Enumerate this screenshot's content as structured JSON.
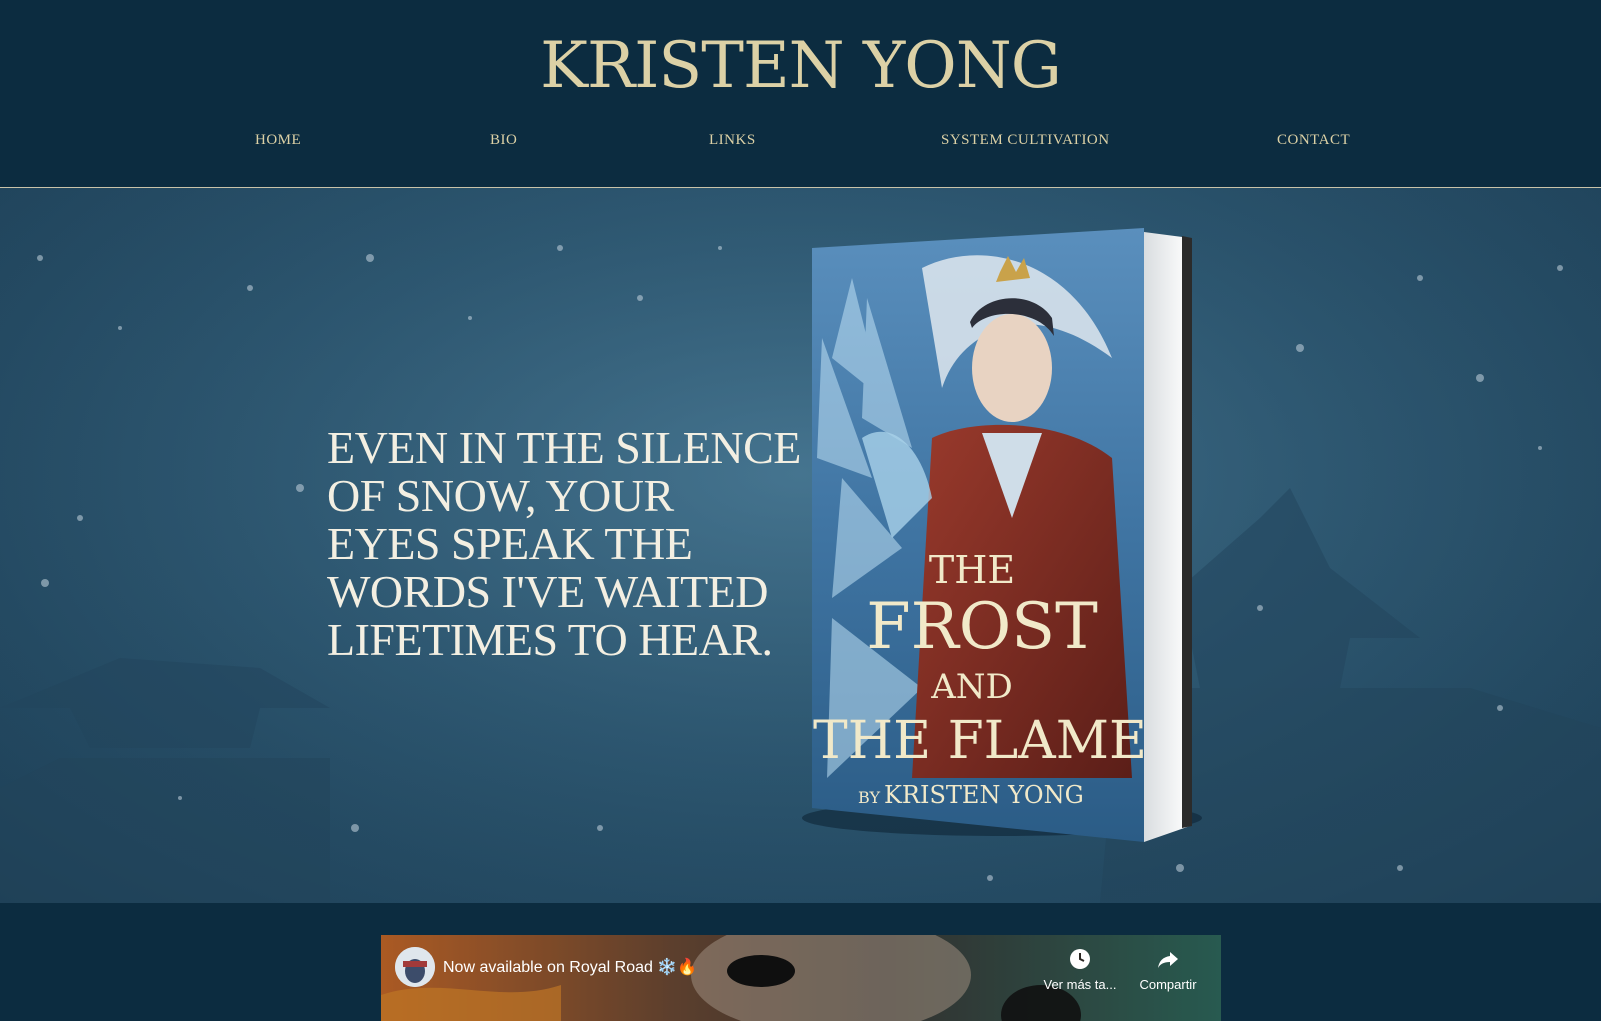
{
  "site": {
    "title": "KRISTEN YONG"
  },
  "nav": {
    "items": [
      {
        "label": "HOME"
      },
      {
        "label": "BIO"
      },
      {
        "label": "LINKS"
      },
      {
        "label": "SYSTEM CULTIVATION"
      },
      {
        "label": "CONTACT"
      }
    ]
  },
  "hero": {
    "quote_lines": [
      "EVEN IN THE SILENCE",
      "OF SNOW, YOUR",
      "EYES SPEAK THE",
      "WORDS I'VE WAITED",
      "LIFETIMES TO HEAR."
    ],
    "book": {
      "title_the": "THE",
      "title_frost": "FROST",
      "title_and": "AND",
      "title_flame": "THE FLAME",
      "author_by": "BY",
      "author": "KRISTEN YONG"
    }
  },
  "video": {
    "title": "Now available on Royal Road ❄️🔥",
    "watch_later_label": "Ver más ta...",
    "share_label": "Compartir",
    "icons": {
      "watch_later": "clock-icon",
      "share": "share-arrow-icon"
    }
  },
  "colors": {
    "background": "#0c2c40",
    "accent_gold": "#dcd1a6",
    "hero_text": "#f3efe2"
  }
}
